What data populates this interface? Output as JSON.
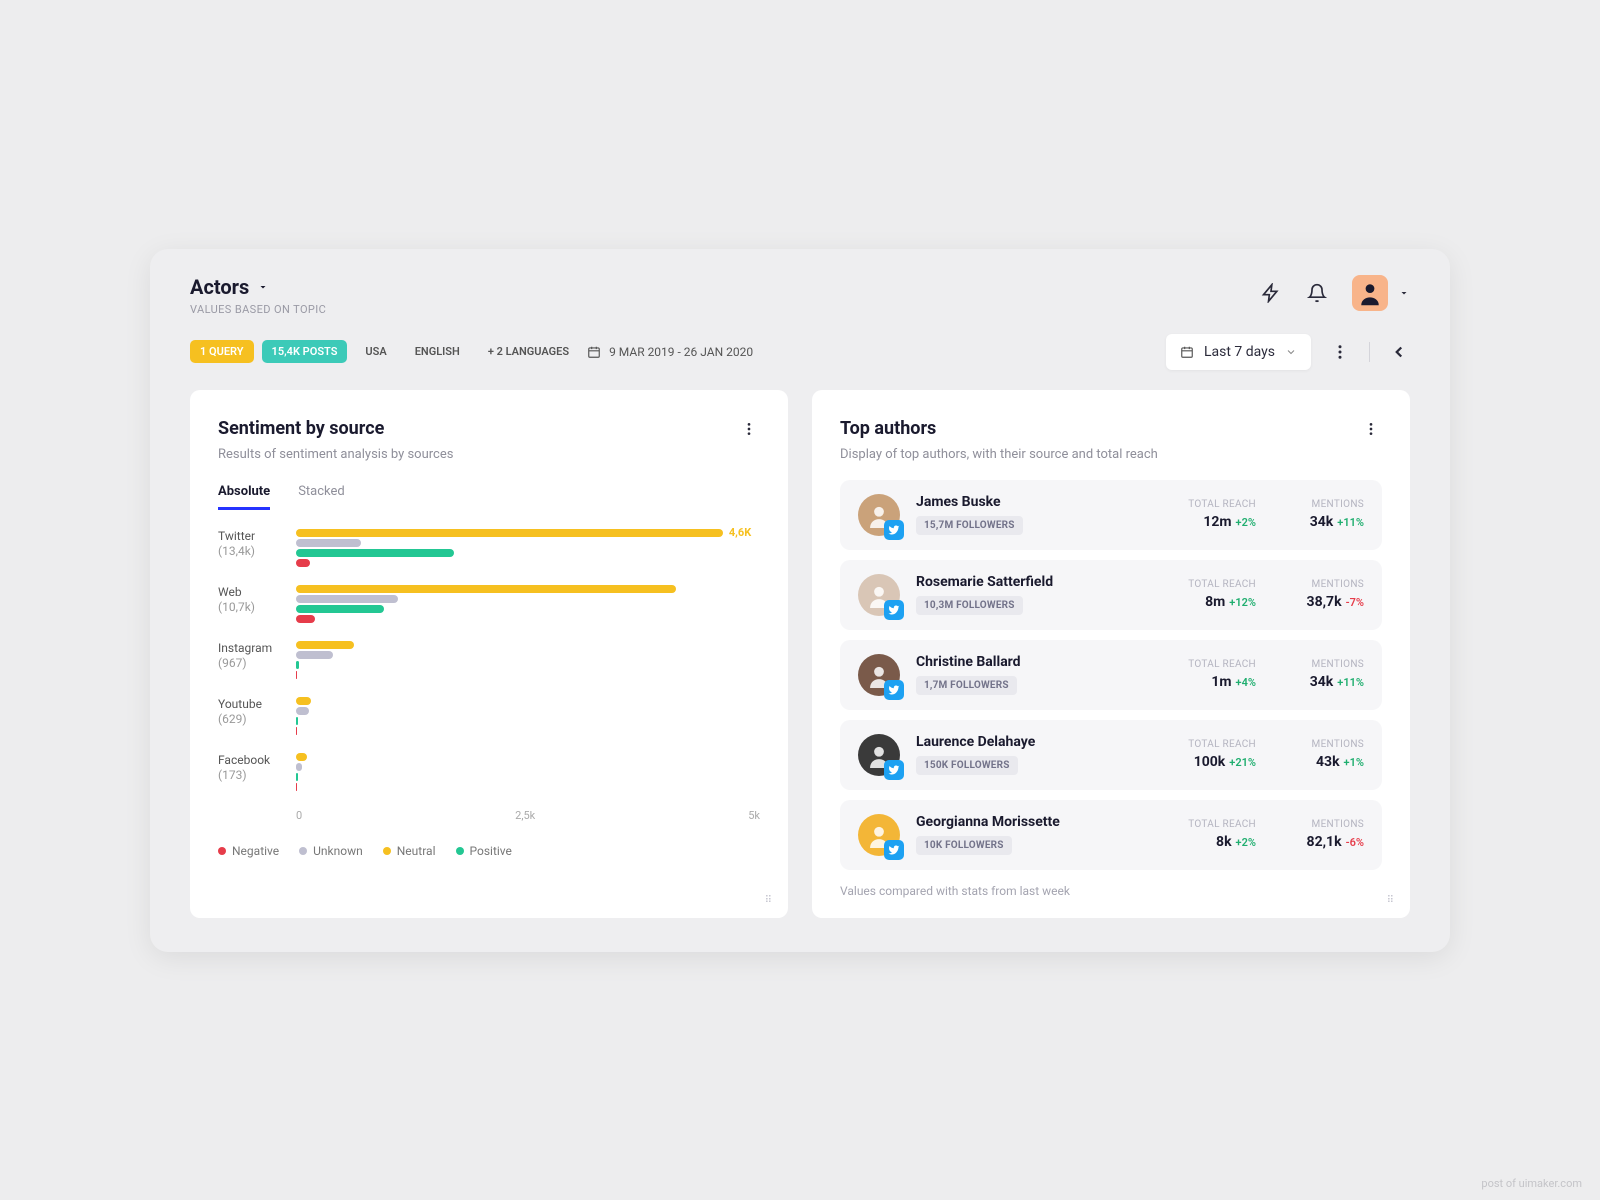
{
  "header": {
    "title": "Actors",
    "subtitle": "VALUES BASED ON TOPIC"
  },
  "filters": {
    "query_chip": "1 QUERY",
    "posts_chip": "15,4K POSTS",
    "country": "USA",
    "language": "ENGLISH",
    "more_languages": "+ 2 LANGUAGES",
    "date_range": "9 MAR 2019 - 26 JAN 2020",
    "period_picker": "Last 7 days"
  },
  "sentiment_card": {
    "title": "Sentiment by source",
    "subtitle": "Results of sentiment analysis by sources",
    "tabs": {
      "absolute": "Absolute",
      "stacked": "Stacked"
    },
    "axis": {
      "t0": "0",
      "t1": "2,5k",
      "t2": "5k"
    },
    "legend": {
      "negative": "Negative",
      "unknown": "Unknown",
      "neutral": "Neutral",
      "positive": "Positive"
    }
  },
  "authors_card": {
    "title": "Top authors",
    "subtitle": "Display of top authors, with their source and total reach",
    "col_reach": "TOTAL REACH",
    "col_mentions": "MENTIONS",
    "footnote": "Values compared with stats from last week"
  },
  "authors": [
    {
      "name": "James Buske",
      "followers": "15,7M FOLLOWERS",
      "reach": "12m",
      "reach_delta": "+2%",
      "reach_dir": "up",
      "mentions": "34k",
      "mentions_delta": "+11%",
      "mentions_dir": "up",
      "avatar_bg": "#caa27a"
    },
    {
      "name": "Rosemarie Satterfield",
      "followers": "10,3M FOLLOWERS",
      "reach": "8m",
      "reach_delta": "+12%",
      "reach_dir": "up",
      "mentions": "38,7k",
      "mentions_delta": "-7%",
      "mentions_dir": "down",
      "avatar_bg": "#d9c6b6"
    },
    {
      "name": "Christine Ballard",
      "followers": "1,7M FOLLOWERS",
      "reach": "1m",
      "reach_delta": "+4%",
      "reach_dir": "up",
      "mentions": "34k",
      "mentions_delta": "+11%",
      "mentions_dir": "up",
      "avatar_bg": "#7a5a4a"
    },
    {
      "name": "Laurence Delahaye",
      "followers": "150K FOLLOWERS",
      "reach": "100k",
      "reach_delta": "+21%",
      "reach_dir": "up",
      "mentions": "43k",
      "mentions_delta": "+1%",
      "mentions_dir": "up",
      "avatar_bg": "#3a3a3a"
    },
    {
      "name": "Georgianna Morissette",
      "followers": "10K FOLLOWERS",
      "reach": "8k",
      "reach_delta": "+2%",
      "reach_dir": "up",
      "mentions": "82,1k",
      "mentions_delta": "-6%",
      "mentions_dir": "down",
      "avatar_bg": "#f3b637"
    }
  ],
  "chart_data": {
    "type": "bar",
    "orientation": "horizontal",
    "xlabel": "",
    "ylabel": "",
    "xlim": [
      0,
      5000
    ],
    "x_ticks": [
      0,
      2500,
      5000
    ],
    "categories": [
      "Twitter",
      "Web",
      "Instagram",
      "Youtube",
      "Facebook"
    ],
    "category_counts": [
      "(13,4k)",
      "(10,7k)",
      "(967)",
      "(629)",
      "(173)"
    ],
    "series": [
      {
        "name": "Neutral",
        "color": "#f6c020",
        "values": [
          4600,
          4100,
          620,
          160,
          120
        ]
      },
      {
        "name": "Unknown",
        "color": "#bfbfd0",
        "values": [
          700,
          1100,
          400,
          140,
          60
        ]
      },
      {
        "name": "Positive",
        "color": "#23c793",
        "values": [
          1700,
          950,
          30,
          25,
          20
        ]
      },
      {
        "name": "Negative",
        "color": "#e63c4a",
        "values": [
          150,
          200,
          15,
          10,
          10
        ]
      }
    ],
    "value_labels": {
      "0": {
        "Neutral": "4,6K"
      }
    },
    "legend": [
      "Negative",
      "Unknown",
      "Neutral",
      "Positive"
    ]
  },
  "colors": {
    "yellow": "#f6c020",
    "teal": "#3ccab8",
    "green": "#23c793",
    "red": "#e63c4a",
    "gray": "#bfbfd0",
    "blue": "#2633ff",
    "twitter": "#1da1f2"
  },
  "watermark": "post of uimaker.com"
}
